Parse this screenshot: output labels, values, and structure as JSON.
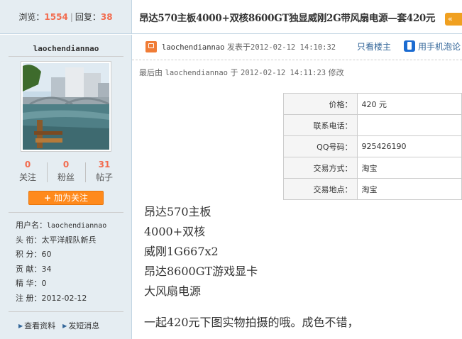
{
  "stats": {
    "views_label": "浏览：",
    "views": "1554",
    "replies_label": "回复：",
    "replies": "38"
  },
  "thread": {
    "title": "昂达570主板4000+双核8600GT独显威刚2G带风扇电源—套420元"
  },
  "user": {
    "name": "laochendiannao",
    "counts": [
      {
        "value": "0",
        "label": "关注"
      },
      {
        "value": "0",
        "label": "粉丝"
      },
      {
        "value": "31",
        "label": "帖子"
      }
    ],
    "follow_button": "加为关注",
    "profile": [
      {
        "key": "用户名：",
        "value": "laochendiannao"
      },
      {
        "key": "头 衔：",
        "value": "太平洋舰队新兵"
      },
      {
        "key": "积 分：",
        "value": "60"
      },
      {
        "key": "贡 献：",
        "value": "34"
      },
      {
        "key": "精 华：",
        "value": "0"
      },
      {
        "key": "注 册：",
        "value": "2012-02-12"
      }
    ],
    "links": [
      "查看资料",
      "发短消息"
    ]
  },
  "post": {
    "author": "laochendiannao",
    "posted_prefix": "发表于",
    "posted_time": "2012-02-12 14:10:32",
    "only_author": "只看楼主",
    "phone_view": "用手机泡论",
    "edited_prefix": "最后由",
    "edited_user": "laochendiannao",
    "edited_mid": "于",
    "edited_time": "2012-02-12 14:11:23",
    "edited_suffix": "修改",
    "info": [
      {
        "label": "价格：",
        "value": "420 元"
      },
      {
        "label": "联系电话：",
        "value": ""
      },
      {
        "label": "QQ号码：",
        "value": "925426190"
      },
      {
        "label": "交易方式：",
        "value": "淘宝"
      },
      {
        "label": "交易地点：",
        "value": "淘宝"
      }
    ],
    "lines": [
      "昂达570主板",
      "4000+双核",
      "威刚1G667x2",
      "昂达8600GT游戏显卡",
      "大风扇电源"
    ],
    "last_line": "一起420元下图实物拍摄的哦。成色不错，"
  },
  "colors": {
    "sidebar_bg": "#e5edf2",
    "accent_orange": "#ff8a1c",
    "count_red": "#f26c4f",
    "link_blue": "#336699"
  }
}
